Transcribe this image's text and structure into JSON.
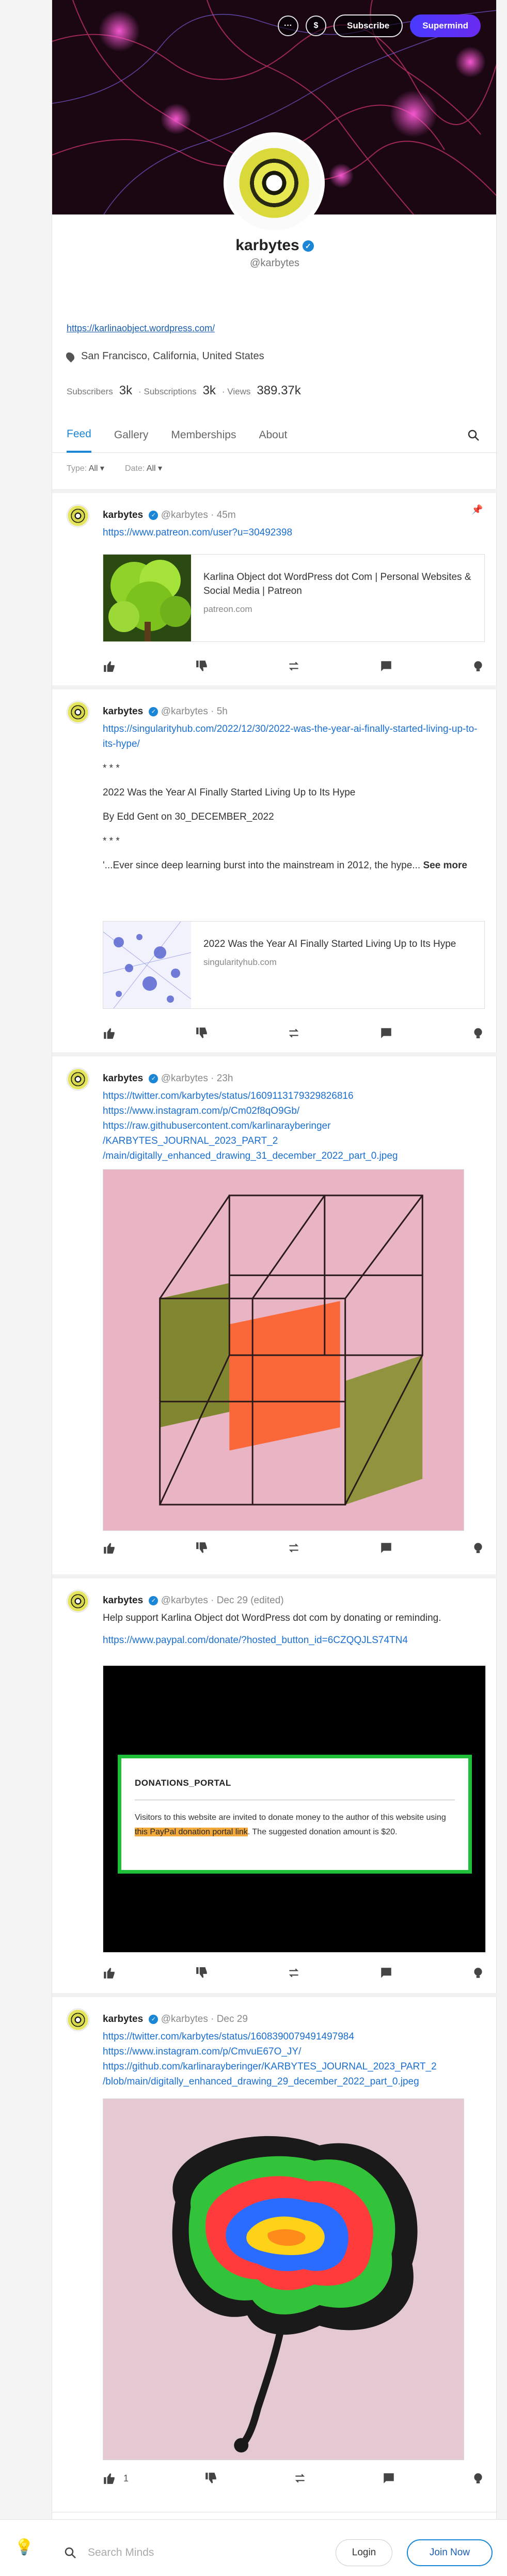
{
  "header": {
    "actions": {
      "more_label": "···",
      "tip_label": "$",
      "subscribe_label": "Subscribe",
      "supermind_label": "Supermind"
    }
  },
  "profile": {
    "name": "karbytes",
    "handle": "@karbytes",
    "website": "https://karlinaobject.wordpress.com/",
    "location": "San Francisco, California, United States",
    "stats": {
      "subscribers_label": "Subscribers",
      "subscribers_value": "3k",
      "subscriptions_label": "· Subscriptions",
      "subscriptions_value": "3k",
      "views_label": "· Views",
      "views_value": "389.37k"
    }
  },
  "tabs": [
    "Feed",
    "Gallery",
    "Memberships",
    "About"
  ],
  "filters": {
    "type_label": "Type:",
    "type_value": "All ▾",
    "date_label": "Date:",
    "date_value": "All ▾"
  },
  "posts": [
    {
      "author": "karbytes",
      "meta": "@karbytes · 45m",
      "link": "https://www.patreon.com/user?u=30492398",
      "card_title": "Karlina Object dot WordPress dot Com | Personal Websites & Social Media | Patreon",
      "card_domain": "patreon.com"
    },
    {
      "author": "karbytes",
      "meta": "@karbytes · 5h",
      "link": "https://singularityhub.com/2022/12/30/2022-was-the-year-ai-finally-started-living-up-to-its-hype/",
      "stars1": "* * *",
      "title": "2022 Was the Year AI Finally Started Living Up to Its Hype",
      "byline": "By Edd Gent on 30_DECEMBER_2022",
      "stars2": "* * *",
      "excerpt": "'...Ever since deep learning burst into the mainstream in 2012, the hype...",
      "see_more": "See more",
      "card_title": "2022 Was the Year AI Finally Started Living Up to Its Hype",
      "card_domain": "singularityhub.com"
    },
    {
      "author": "karbytes",
      "meta": "@karbytes · 23h",
      "links": [
        "https://twitter.com/karbytes/status/1609113179329826816",
        "https://www.instagram.com/p/Cm02f8qO9Gb/",
        "https://raw.githubusercontent.com/karlinarayberinger",
        "/KARBYTES_JOURNAL_2023_PART_2",
        "/main/digitally_enhanced_drawing_31_december_2022_part_0.jpeg"
      ]
    },
    {
      "author": "karbytes",
      "meta": "@karbytes · Dec 29 (edited)",
      "text": "Help support Karlina Object dot WordPress dot com by donating or reminding.",
      "link": "https://www.paypal.com/donate/?hosted_button_id=6CZQQJLS74TN4",
      "donate_title": "DONATIONS_PORTAL",
      "donate_pre": "Visitors to this website are invited to donate money to the author of this website using ",
      "donate_link": "this PayPal donation portal link",
      "donate_post": ". The suggested donation amount is $20."
    },
    {
      "author": "karbytes",
      "meta": "@karbytes · Dec 29",
      "links": [
        "https://twitter.com/karbytes/status/1608390079491497984",
        "https://www.instagram.com/p/CmvuE67O_JY/",
        "https://github.com/karlinarayberinger/KARBYTES_JOURNAL_2023_PART_2",
        "/blob/main/digitally_enhanced_drawing_29_december_2022_part_0.jpeg"
      ],
      "upvotes": "1"
    }
  ],
  "bottom_bar": {
    "search_placeholder": "Search Minds",
    "login_label": "Login",
    "join_label": "Join Now"
  },
  "colors": {
    "accent": "#1b85d6",
    "supermind": "#4a3aff",
    "donate_border": "#1fbf3a"
  }
}
